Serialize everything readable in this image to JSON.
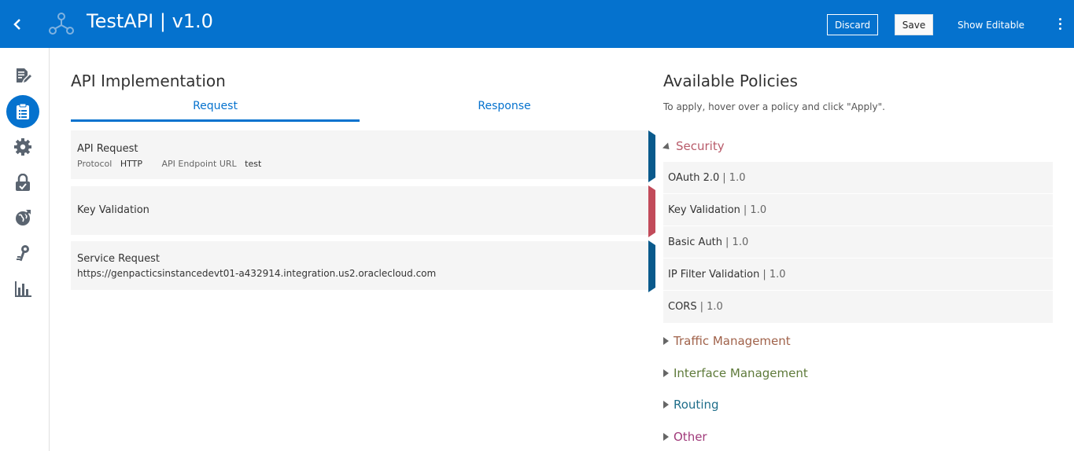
{
  "header": {
    "title": "TestAPI | v1.0",
    "discard_label": "Discard",
    "save_label": "Save",
    "show_editable_label": "Show Editable",
    "back_icon": "chevron-left-icon",
    "app_icon": "api-nodes-icon",
    "menu_icon": "kebab-menu-icon",
    "background_color": "#0572ce"
  },
  "sidebar": {
    "items": [
      {
        "name": "document-edit-icon",
        "active": false
      },
      {
        "name": "api-implementation-icon",
        "active": true
      },
      {
        "name": "settings-gear-icon",
        "active": false
      },
      {
        "name": "lock-icon",
        "active": false
      },
      {
        "name": "globe-icon",
        "active": false
      },
      {
        "name": "keys-icon",
        "active": false
      },
      {
        "name": "analytics-chart-icon",
        "active": false
      }
    ]
  },
  "implementation": {
    "title": "API Implementation",
    "tabs": [
      {
        "label": "Request",
        "active": true
      },
      {
        "label": "Response",
        "active": false
      }
    ],
    "cards": [
      {
        "title": "API Request",
        "protocol_label": "Protocol",
        "protocol_value": "HTTP",
        "endpoint_label": "API Endpoint URL",
        "endpoint_value": "test",
        "connector_color": "#0a5a8c"
      },
      {
        "title": "Key Validation",
        "connector_color": "#c24b5a"
      },
      {
        "title": "Service Request",
        "url": "https://genpacticsinstancedevt01-a432914.integration.us2.oraclecloud.com",
        "connector_color": "#0a5a8c"
      }
    ]
  },
  "policies": {
    "title": "Available Policies",
    "hint": "To apply, hover over a policy and click \"Apply\".",
    "categories": [
      {
        "label": "Security",
        "expanded": true,
        "color": "#b85b6a"
      },
      {
        "label": "Traffic Management",
        "expanded": false,
        "color": "#a0624a"
      },
      {
        "label": "Interface Management",
        "expanded": false,
        "color": "#5e7a3a"
      },
      {
        "label": "Routing",
        "expanded": false,
        "color": "#1f6e8a"
      },
      {
        "label": "Other",
        "expanded": false,
        "color": "#a03a7a"
      }
    ],
    "security_items": [
      {
        "name": "OAuth 2.0",
        "version": "| 1.0"
      },
      {
        "name": "Key Validation",
        "version": "| 1.0"
      },
      {
        "name": "Basic Auth",
        "version": "| 1.0"
      },
      {
        "name": "IP Filter Validation",
        "version": "| 1.0"
      },
      {
        "name": "CORS",
        "version": "| 1.0"
      }
    ]
  }
}
